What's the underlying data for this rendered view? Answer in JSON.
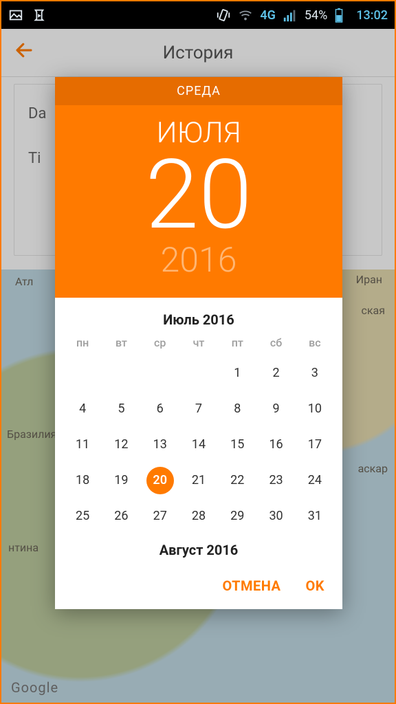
{
  "status": {
    "battery_pct": "54%",
    "clock": "13:02",
    "net_label": "4G"
  },
  "header": {
    "title": "История"
  },
  "background_panel": {
    "row1": "Da",
    "row2": "Ti"
  },
  "map_labels": {
    "atl": "Атл",
    "iran": "Иран",
    "brazil": "Бразилия",
    "madagascar": "аскар",
    "argentina": "нтина",
    "kia": "ская",
    "google": "Google"
  },
  "datepicker": {
    "dow_header": "СРЕДА",
    "selected_month_gen": "ИЮЛЯ",
    "selected_day": "20",
    "selected_year": "2016",
    "cal_title": "Июль 2016",
    "weekdays": [
      "пн",
      "вт",
      "ср",
      "чт",
      "пт",
      "сб",
      "вс"
    ],
    "lead_blanks": 4,
    "days_in_month": 31,
    "selected_index": 20,
    "next_month_title": "Август 2016",
    "cancel": "ОТМЕНА",
    "ok": "OK"
  },
  "colors": {
    "accent": "#ff7a00",
    "accent_dark": "#e66c00"
  }
}
